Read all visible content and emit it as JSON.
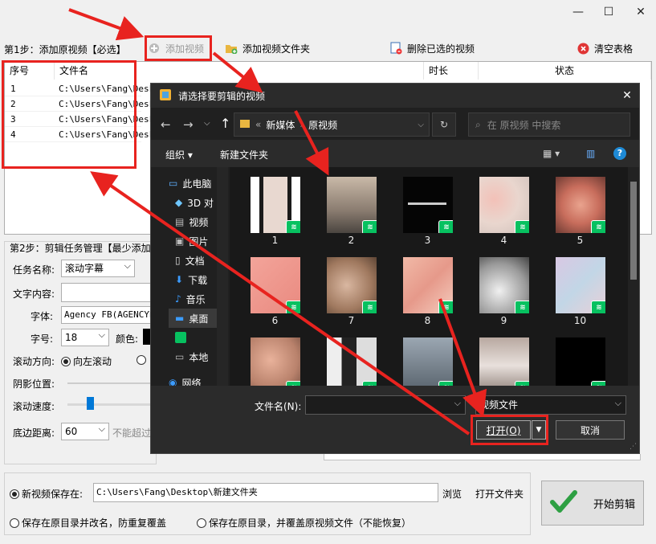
{
  "window": {
    "minimize": "—",
    "maximize": "☐",
    "close": "✕"
  },
  "step1": {
    "label": "第1步：添加原视频【必选】",
    "add_video": "添加视频",
    "add_folder": "添加视频文件夹",
    "delete_selected": "删除已选的视频",
    "clear_table": "清空表格"
  },
  "table": {
    "headers": [
      "序号",
      "文件名",
      "时长",
      "状态"
    ],
    "rows": [
      {
        "index": "1",
        "file": "C:\\Users\\Fang\\Deskt"
      },
      {
        "index": "2",
        "file": "C:\\Users\\Fang\\Deskt"
      },
      {
        "index": "3",
        "file": "C:\\Users\\Fang\\Deskt"
      },
      {
        "index": "4",
        "file": "C:\\Users\\Fang\\Deskt"
      }
    ]
  },
  "step2": {
    "label": "第2步：剪辑任务管理【最少添加",
    "task_name_label": "任务名称:",
    "task_name_value": "滚动字幕",
    "text_content_label": "文字内容:",
    "font_label": "字体:",
    "font_value": "Agency FB(AGENCYB.",
    "size_label": "字号:",
    "size_value": "18",
    "color_label": "颜色:",
    "direction_label": "滚动方向:",
    "direction_left": "向左滚动",
    "shadow_label": "阴影位置:",
    "speed_label": "滚动速度:",
    "bottom_label": "底边距离:",
    "bottom_value": "60",
    "bottom_hint": "不能超过"
  },
  "save": {
    "new_location_label": "新视频保存在:",
    "path": "C:\\Users\\Fang\\Desktop\\新建文件夹",
    "browse": "浏览",
    "open_folder": "打开文件夹",
    "option_rename": "保存在原目录并改名，防重复覆盖",
    "option_overwrite": "保存在原目录，并覆盖原视频文件（不能恢复）",
    "start": "开始剪辑"
  },
  "dialog": {
    "title": "请选择要剪辑的视频",
    "close": "✕",
    "breadcrumb": [
      "新媒体",
      "原视频"
    ],
    "search_placeholder": "在 原视频 中搜索",
    "organize": "组织 ▾",
    "new_folder": "新建文件夹",
    "sidebar": [
      "此电脑",
      "3D 对",
      "视频",
      "图片",
      "文档",
      "下载",
      "音乐",
      "桌面",
      "",
      "本地",
      "网络"
    ],
    "files": [
      "1",
      "2",
      "3",
      "4",
      "5",
      "6",
      "7",
      "8",
      "9",
      "10",
      "",
      "",
      "",
      "",
      ""
    ],
    "filename_label": "文件名(N):",
    "filetype": "视频文件",
    "open": "打开(O)",
    "cancel": "取消"
  },
  "colors": {
    "annotation": "#e8231f",
    "wechat": "#07c160",
    "accent": "#0078d7"
  }
}
